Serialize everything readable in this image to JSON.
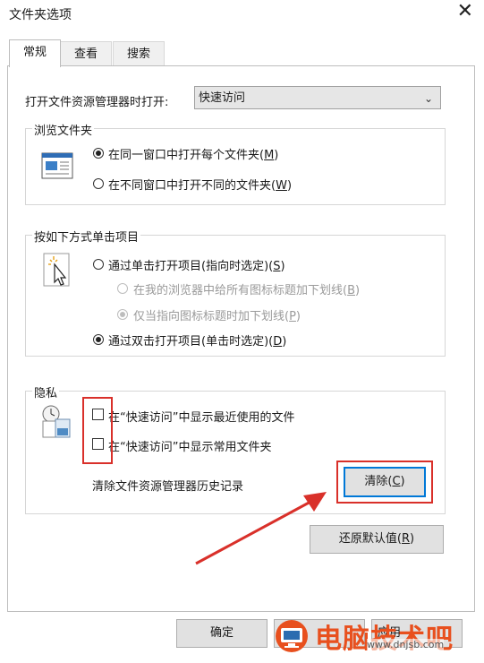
{
  "window": {
    "title": "文件夹选项",
    "close_glyph": "✕"
  },
  "tabs": [
    {
      "label": "常规",
      "active": true
    },
    {
      "label": "查看",
      "active": false
    },
    {
      "label": "搜索",
      "active": false
    }
  ],
  "open_explorer": {
    "label": "打开文件资源管理器时打开:",
    "value": "快速访问"
  },
  "browse_folders": {
    "title": "浏览文件夹",
    "opt1_prefix": "在同一窗口中打开每个文件夹(",
    "opt1_key": "M",
    "opt1_suffix": ")",
    "opt2_prefix": "在不同窗口中打开不同的文件夹(",
    "opt2_key": "W",
    "opt2_suffix": ")"
  },
  "click_items": {
    "title": "按如下方式单击项目",
    "single_prefix": "通过单击打开项目(指向时选定)(",
    "single_key": "S",
    "single_suffix": ")",
    "underline_all_prefix": "在我的浏览器中给所有图标标题加下划线(",
    "underline_all_key": "B",
    "underline_all_suffix": ")",
    "underline_point_prefix": "仅当指向图标标题时加下划线(",
    "underline_point_key": "P",
    "underline_point_suffix": ")",
    "double_prefix": "通过双击打开项目(单击时选定)(",
    "double_key": "D",
    "double_suffix": ")"
  },
  "privacy": {
    "title": "隐私",
    "recent_files": "在“快速访问”中显示最近使用的文件",
    "frequent_folders": "在“快速访问”中显示常用文件夹",
    "clear_history_label": "清除文件资源管理器历史记录",
    "clear_button_prefix": "清除(",
    "clear_button_key": "C",
    "clear_button_suffix": ")"
  },
  "restore_defaults": {
    "prefix": "还原默认值(",
    "key": "R",
    "suffix": ")"
  },
  "footer": {
    "ok": "确定",
    "apply_partial": "应用"
  },
  "watermark": {
    "brand": "电脑技术吧",
    "url": "www.dnjsb.com"
  },
  "colors": {
    "highlight_red": "#d9302a",
    "focus_blue": "#0078d7",
    "brand_orange": "#e8501e"
  }
}
